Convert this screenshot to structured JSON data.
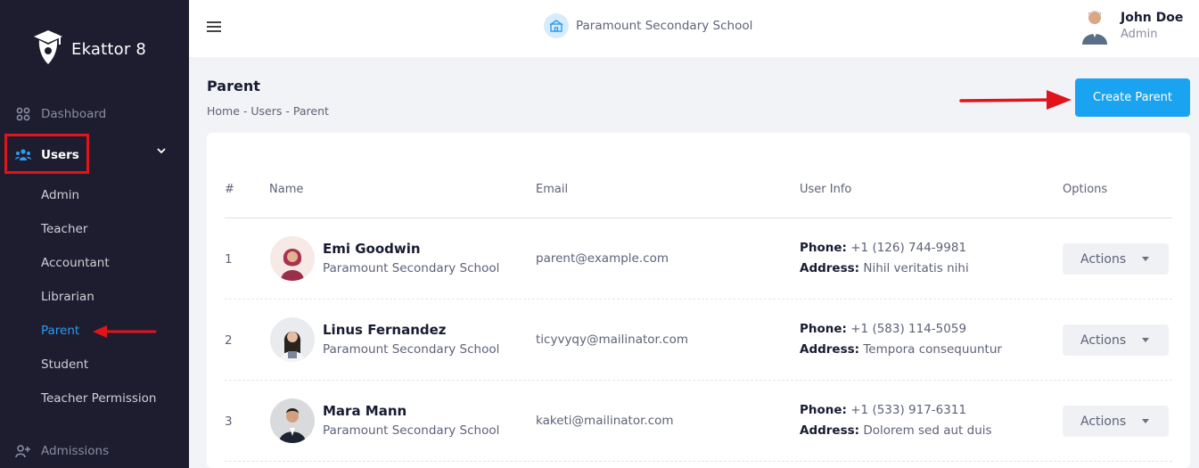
{
  "brand": {
    "name": "Ekattor 8"
  },
  "sidebar": {
    "dashboard": "Dashboard",
    "users": "Users",
    "sub_items": [
      "Admin",
      "Teacher",
      "Accountant",
      "Librarian",
      "Parent",
      "Student",
      "Teacher Permission"
    ],
    "admissions": "Admissions"
  },
  "topbar": {
    "school": "Paramount Secondary School",
    "user_name": "John Doe",
    "user_role": "Admin"
  },
  "page": {
    "title": "Parent",
    "breadcrumb": [
      "Home",
      "Users",
      "Parent"
    ],
    "create_button": "Create Parent"
  },
  "table": {
    "headers": [
      "#",
      "Name",
      "Email",
      "User Info",
      "Options"
    ],
    "phone_label": "Phone:",
    "address_label": "Address:",
    "actions_label": "Actions",
    "rows": [
      {
        "num": "1",
        "name": "Emi Goodwin",
        "school": "Paramount Secondary School",
        "email": "parent@example.com",
        "phone": "+1 (126) 744-9981",
        "address": "Nihil veritatis nihi"
      },
      {
        "num": "2",
        "name": "Linus Fernandez",
        "school": "Paramount Secondary School",
        "email": "ticyvyqy@mailinator.com",
        "phone": "+1 (583) 114-5059",
        "address": "Tempora consequuntur"
      },
      {
        "num": "3",
        "name": "Mara Mann",
        "school": "Paramount Secondary School",
        "email": "kaketi@mailinator.com",
        "phone": "+1 (533) 917-6311",
        "address": "Dolorem sed aut duis"
      }
    ]
  },
  "colors": {
    "accent": "#1aa3f0",
    "sidebar_bg": "#1d1d2f",
    "highlight": "#e0141a"
  },
  "icons": [
    "graduation-cap-logo-icon",
    "dashboard-grid-icon",
    "users-icon",
    "chevron-down-icon",
    "menu-icon",
    "school-icon",
    "user-plus-icon"
  ]
}
